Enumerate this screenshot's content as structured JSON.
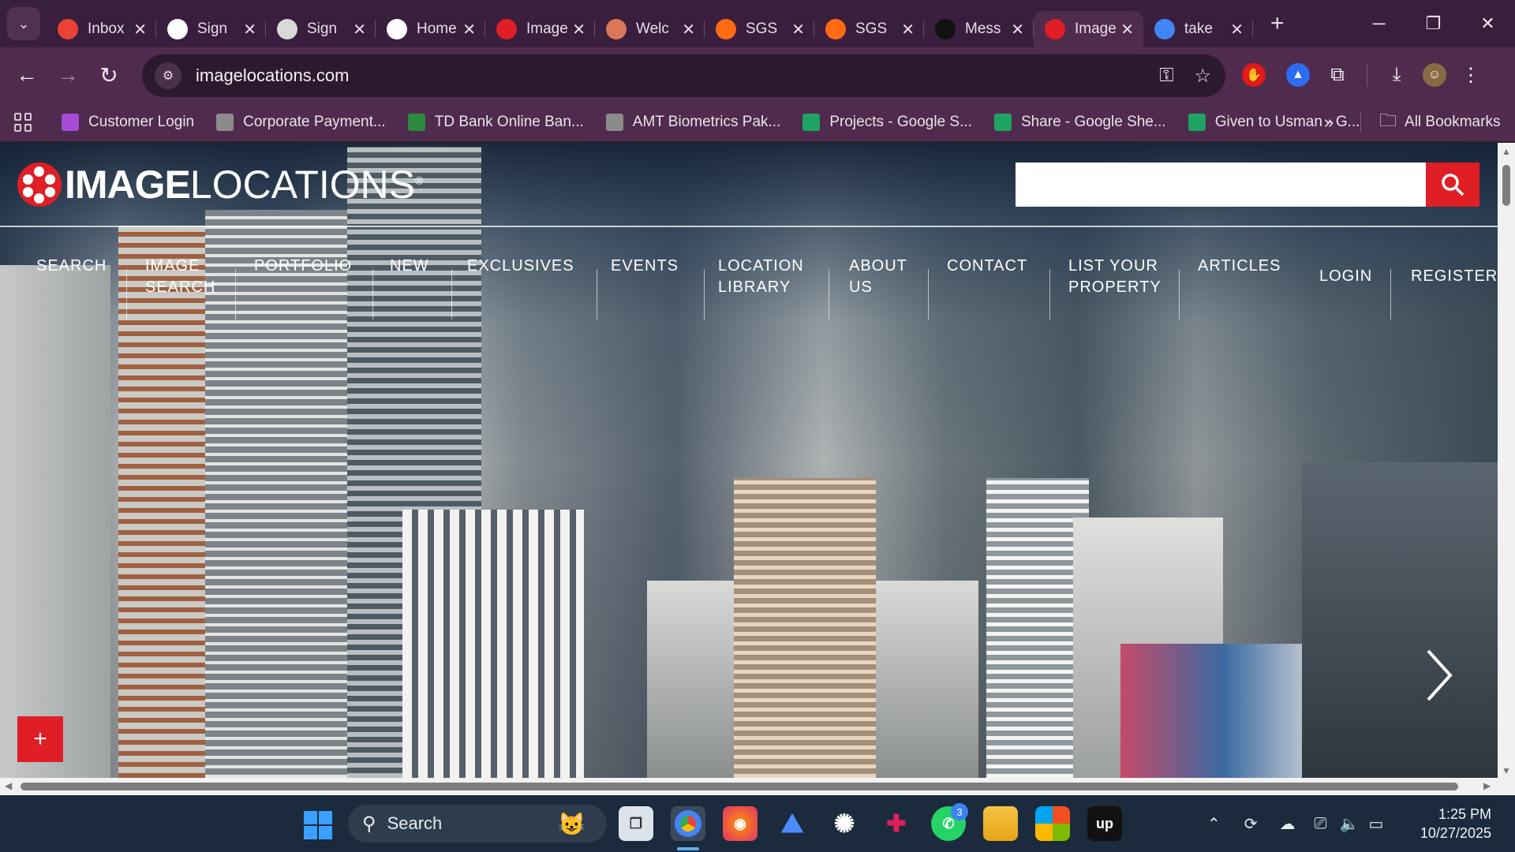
{
  "browser": {
    "tabs": [
      {
        "title": "Inbox",
        "favicon": "gmail-icon",
        "color": "#ea4335"
      },
      {
        "title": "Sign",
        "favicon": "github-icon",
        "color": "#ffffff"
      },
      {
        "title": "Sign",
        "favicon": "u-icon",
        "color": "#d9d9d9"
      },
      {
        "title": "Home",
        "favicon": "photo-icon",
        "color": "#ffffff"
      },
      {
        "title": "Image",
        "favicon": "reel-icon",
        "color": "#e01e26"
      },
      {
        "title": "Welc",
        "favicon": "claude-icon",
        "color": "#d97757"
      },
      {
        "title": "SGS",
        "favicon": "sgs-icon",
        "color": "#ff6a13"
      },
      {
        "title": "SGS",
        "favicon": "sgs-icon",
        "color": "#ff6a13"
      },
      {
        "title": "Mess",
        "favicon": "upwork-icon",
        "color": "#111111"
      },
      {
        "title": "Image",
        "favicon": "reel-icon",
        "color": "#e01e26",
        "active": true
      },
      {
        "title": "take",
        "favicon": "google-icon",
        "color": "#4285f4"
      }
    ],
    "url": "imagelocations.com",
    "bookmarks": [
      {
        "label": "Customer Login",
        "icon": "feather-icon",
        "color": "#a64dd8"
      },
      {
        "label": "Corporate Payment...",
        "icon": "globe-icon",
        "color": "#8b8b8b"
      },
      {
        "label": "TD Bank Online Ban...",
        "icon": "td-icon",
        "color": "#2b8a3e"
      },
      {
        "label": "AMT Biometrics Pak...",
        "icon": "globe-icon",
        "color": "#8b8b8b"
      },
      {
        "label": "Projects - Google S...",
        "icon": "sheets-icon",
        "color": "#1ea362"
      },
      {
        "label": "Share - Google She...",
        "icon": "sheets-icon",
        "color": "#1ea362"
      },
      {
        "label": "Given to Usman - G...",
        "icon": "sheets-icon",
        "color": "#1ea362"
      }
    ],
    "more_bookmarks": "»",
    "all_bookmarks": "All Bookmarks"
  },
  "site": {
    "logo_bold": "IMAGE",
    "logo_thin": "LOCATIONS",
    "logo_mark": "®",
    "nav": [
      {
        "line1": "SEARCH",
        "line2": ""
      },
      {
        "line1": "IMAGE",
        "line2": "SEARCH"
      },
      {
        "line1": "PORTFOLIO",
        "line2": ""
      },
      {
        "line1": "NEW",
        "line2": ""
      },
      {
        "line1": "EXCLUSIVES",
        "line2": ""
      },
      {
        "line1": "EVENTS",
        "line2": ""
      },
      {
        "line1": "LOCATION",
        "line2": "LIBRARY"
      },
      {
        "line1": "ABOUT",
        "line2": "US"
      },
      {
        "line1": "CONTACT",
        "line2": ""
      },
      {
        "line1": "LIST YOUR",
        "line2": "PROPERTY"
      },
      {
        "line1": "ARTICLES",
        "line2": ""
      }
    ],
    "login": "LOGIN",
    "register": "REGISTER",
    "plus": "+",
    "accent": "#e01e26"
  },
  "taskbar": {
    "search_label": "Search",
    "whatsapp_badge": "3",
    "time": "1:25 PM",
    "date": "10/27/2025"
  }
}
